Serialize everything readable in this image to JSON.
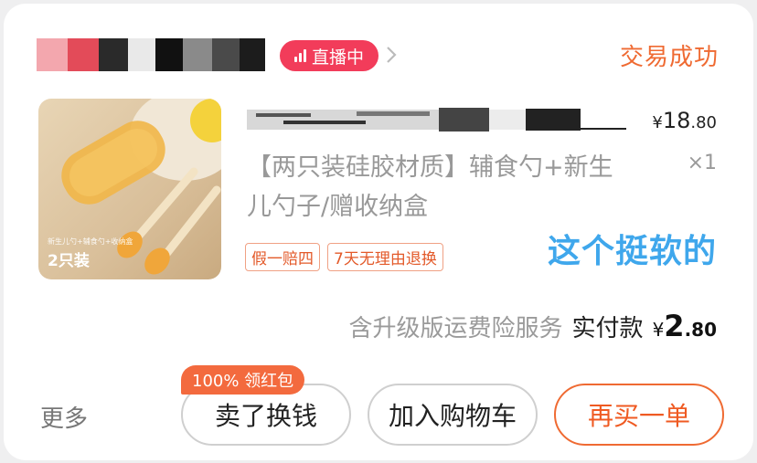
{
  "shop": {
    "live_label": "直播中"
  },
  "order": {
    "status": "交易成功"
  },
  "product": {
    "thumb_caption": "2只装",
    "thumb_small_text": "新生儿勺+辅食勺+收纳盒",
    "description": "【两只装硅胶材质】辅食勺+新生儿勺子/赠收纳盒",
    "price_symbol": "¥",
    "price_int": "18",
    "price_dec": ".80",
    "quantity": "×1",
    "tags": [
      "假一赔四",
      "7天无理由退换"
    ],
    "overlay_note": "这个挺软的"
  },
  "summary": {
    "service": "含升级版运费险服务",
    "paid_label": "实付款",
    "pay_symbol": "¥",
    "pay_int": "2",
    "pay_dec": ".80"
  },
  "actions": {
    "more": "更多",
    "promo": "100% 领红包",
    "sell": "卖了换钱",
    "add_to_cart": "加入购物车",
    "rebuy": "再买一单"
  },
  "colors": {
    "accent": "#ef6a32",
    "live": "#f23c5a",
    "overlay": "#3fa7ec"
  }
}
